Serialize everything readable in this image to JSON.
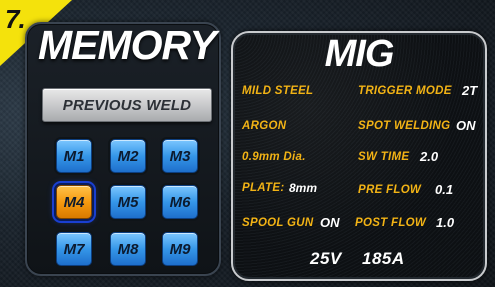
{
  "step": {
    "number": "7."
  },
  "memory": {
    "title": "MEMORY",
    "previous_weld_label": "PREVIOUS WELD",
    "slots": [
      {
        "label": "M1",
        "active": false
      },
      {
        "label": "M2",
        "active": false
      },
      {
        "label": "M3",
        "active": false
      },
      {
        "label": "M4",
        "active": true
      },
      {
        "label": "M5",
        "active": false
      },
      {
        "label": "M6",
        "active": false
      },
      {
        "label": "M7",
        "active": false
      },
      {
        "label": "M8",
        "active": false
      },
      {
        "label": "M9",
        "active": false
      }
    ]
  },
  "settings": {
    "mode_title": "MIG",
    "material": "MILD STEEL",
    "gas": "ARGON",
    "wire": "0.9mm Dia.",
    "plate_label": "PLATE:",
    "plate_value": "8mm",
    "spool_gun_label": "SPOOL GUN",
    "spool_gun_value": "ON",
    "trigger_mode_label": "TRIGGER MODE",
    "trigger_mode_value": "2T",
    "spot_welding_label": "SPOT WELDING",
    "spot_welding_value": "ON",
    "sw_time_label": "SW TIME",
    "sw_time_value": "2.0",
    "pre_flow_label": "PRE FLOW",
    "pre_flow_value": "0.1",
    "post_flow_label": "POST FLOW",
    "post_flow_value": "1.0",
    "voltage": "25V",
    "current": "185A"
  },
  "colors": {
    "accent_yellow": "#f4e20c",
    "label_orange": "#f2b315",
    "memory_button_blue": "#3596e8",
    "memory_button_active": "#f59a10"
  }
}
